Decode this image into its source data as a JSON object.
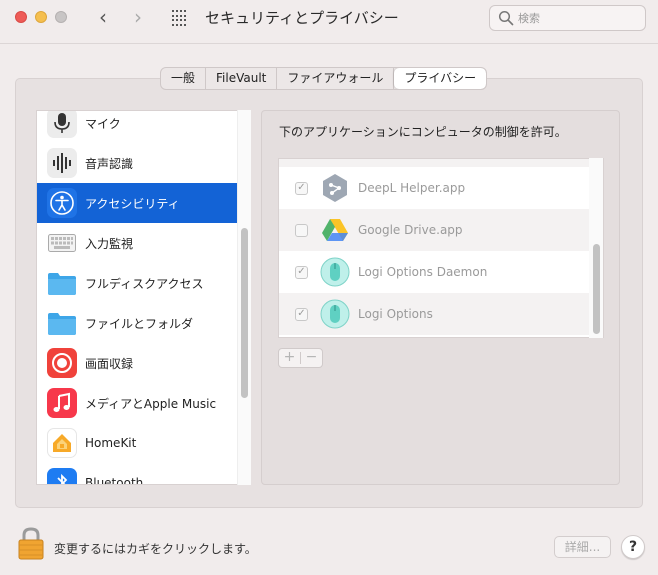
{
  "window": {
    "title": "セキュリティとプライバシー",
    "back_glyph": "‹",
    "forward_glyph": "›",
    "search_placeholder": "検索"
  },
  "tabs": [
    {
      "label": "一般",
      "active": false
    },
    {
      "label": "FileVault",
      "active": false
    },
    {
      "label": "ファイアウォール",
      "active": false
    },
    {
      "label": "プライバシー",
      "active": true
    }
  ],
  "categories": [
    {
      "label": "マイク",
      "icon": "microphone-icon"
    },
    {
      "label": "音声認識",
      "icon": "waveform-icon"
    },
    {
      "label": "アクセシビリティ",
      "icon": "accessibility-icon",
      "selected": true
    },
    {
      "label": "入力監視",
      "icon": "keyboard-icon"
    },
    {
      "label": "フルディスクアクセス",
      "icon": "folder-icon"
    },
    {
      "label": "ファイルとフォルダ",
      "icon": "folder-icon"
    },
    {
      "label": "画面収録",
      "icon": "screen-record-icon"
    },
    {
      "label": "メディアとApple Music",
      "icon": "music-icon"
    },
    {
      "label": "HomeKit",
      "icon": "homekit-icon"
    },
    {
      "label": "Bluetooth",
      "icon": "bluetooth-icon"
    }
  ],
  "right": {
    "heading": "下のアプリケーションにコンピュータの制御を許可。",
    "apps": [
      {
        "name": "DeepL Helper.app",
        "checked": true,
        "icon": "deepl-icon"
      },
      {
        "name": "Google Drive.app",
        "checked": false,
        "icon": "google-drive-icon"
      },
      {
        "name": "Logi Options Daemon",
        "checked": true,
        "icon": "logi-mouse-icon"
      },
      {
        "name": "Logi Options",
        "checked": true,
        "icon": "logi-mouse-icon"
      }
    ],
    "add_label": "+",
    "remove_label": "−"
  },
  "footer": {
    "lock_text": "変更するにはカギをクリックします。",
    "details_label": "詳細...",
    "help_label": "?"
  },
  "colors": {
    "selection": "#1363d6",
    "folder": "#3ea6e8",
    "screen_record": "#f0423b",
    "music": "#f7384b"
  }
}
